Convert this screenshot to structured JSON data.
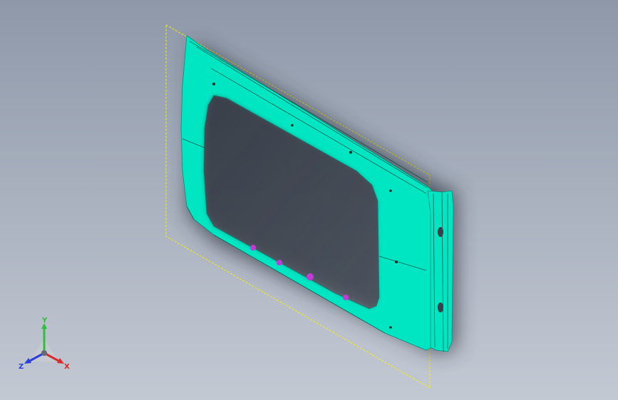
{
  "viewport": {
    "part_name": "",
    "background_top": "#8e98a9",
    "background_bottom": "#c3c9d3"
  },
  "part": {
    "color": "#00e6c3",
    "shadow_color": "#2f3640",
    "bounding_box_color": "#f2f200",
    "fastener_color": "#c23bd6"
  },
  "triad": {
    "x_label": "X",
    "y_label": "Y",
    "z_label": "Z",
    "x_color": "#d92b2b",
    "y_color": "#2fbf3a",
    "z_color": "#2b3fd9"
  }
}
